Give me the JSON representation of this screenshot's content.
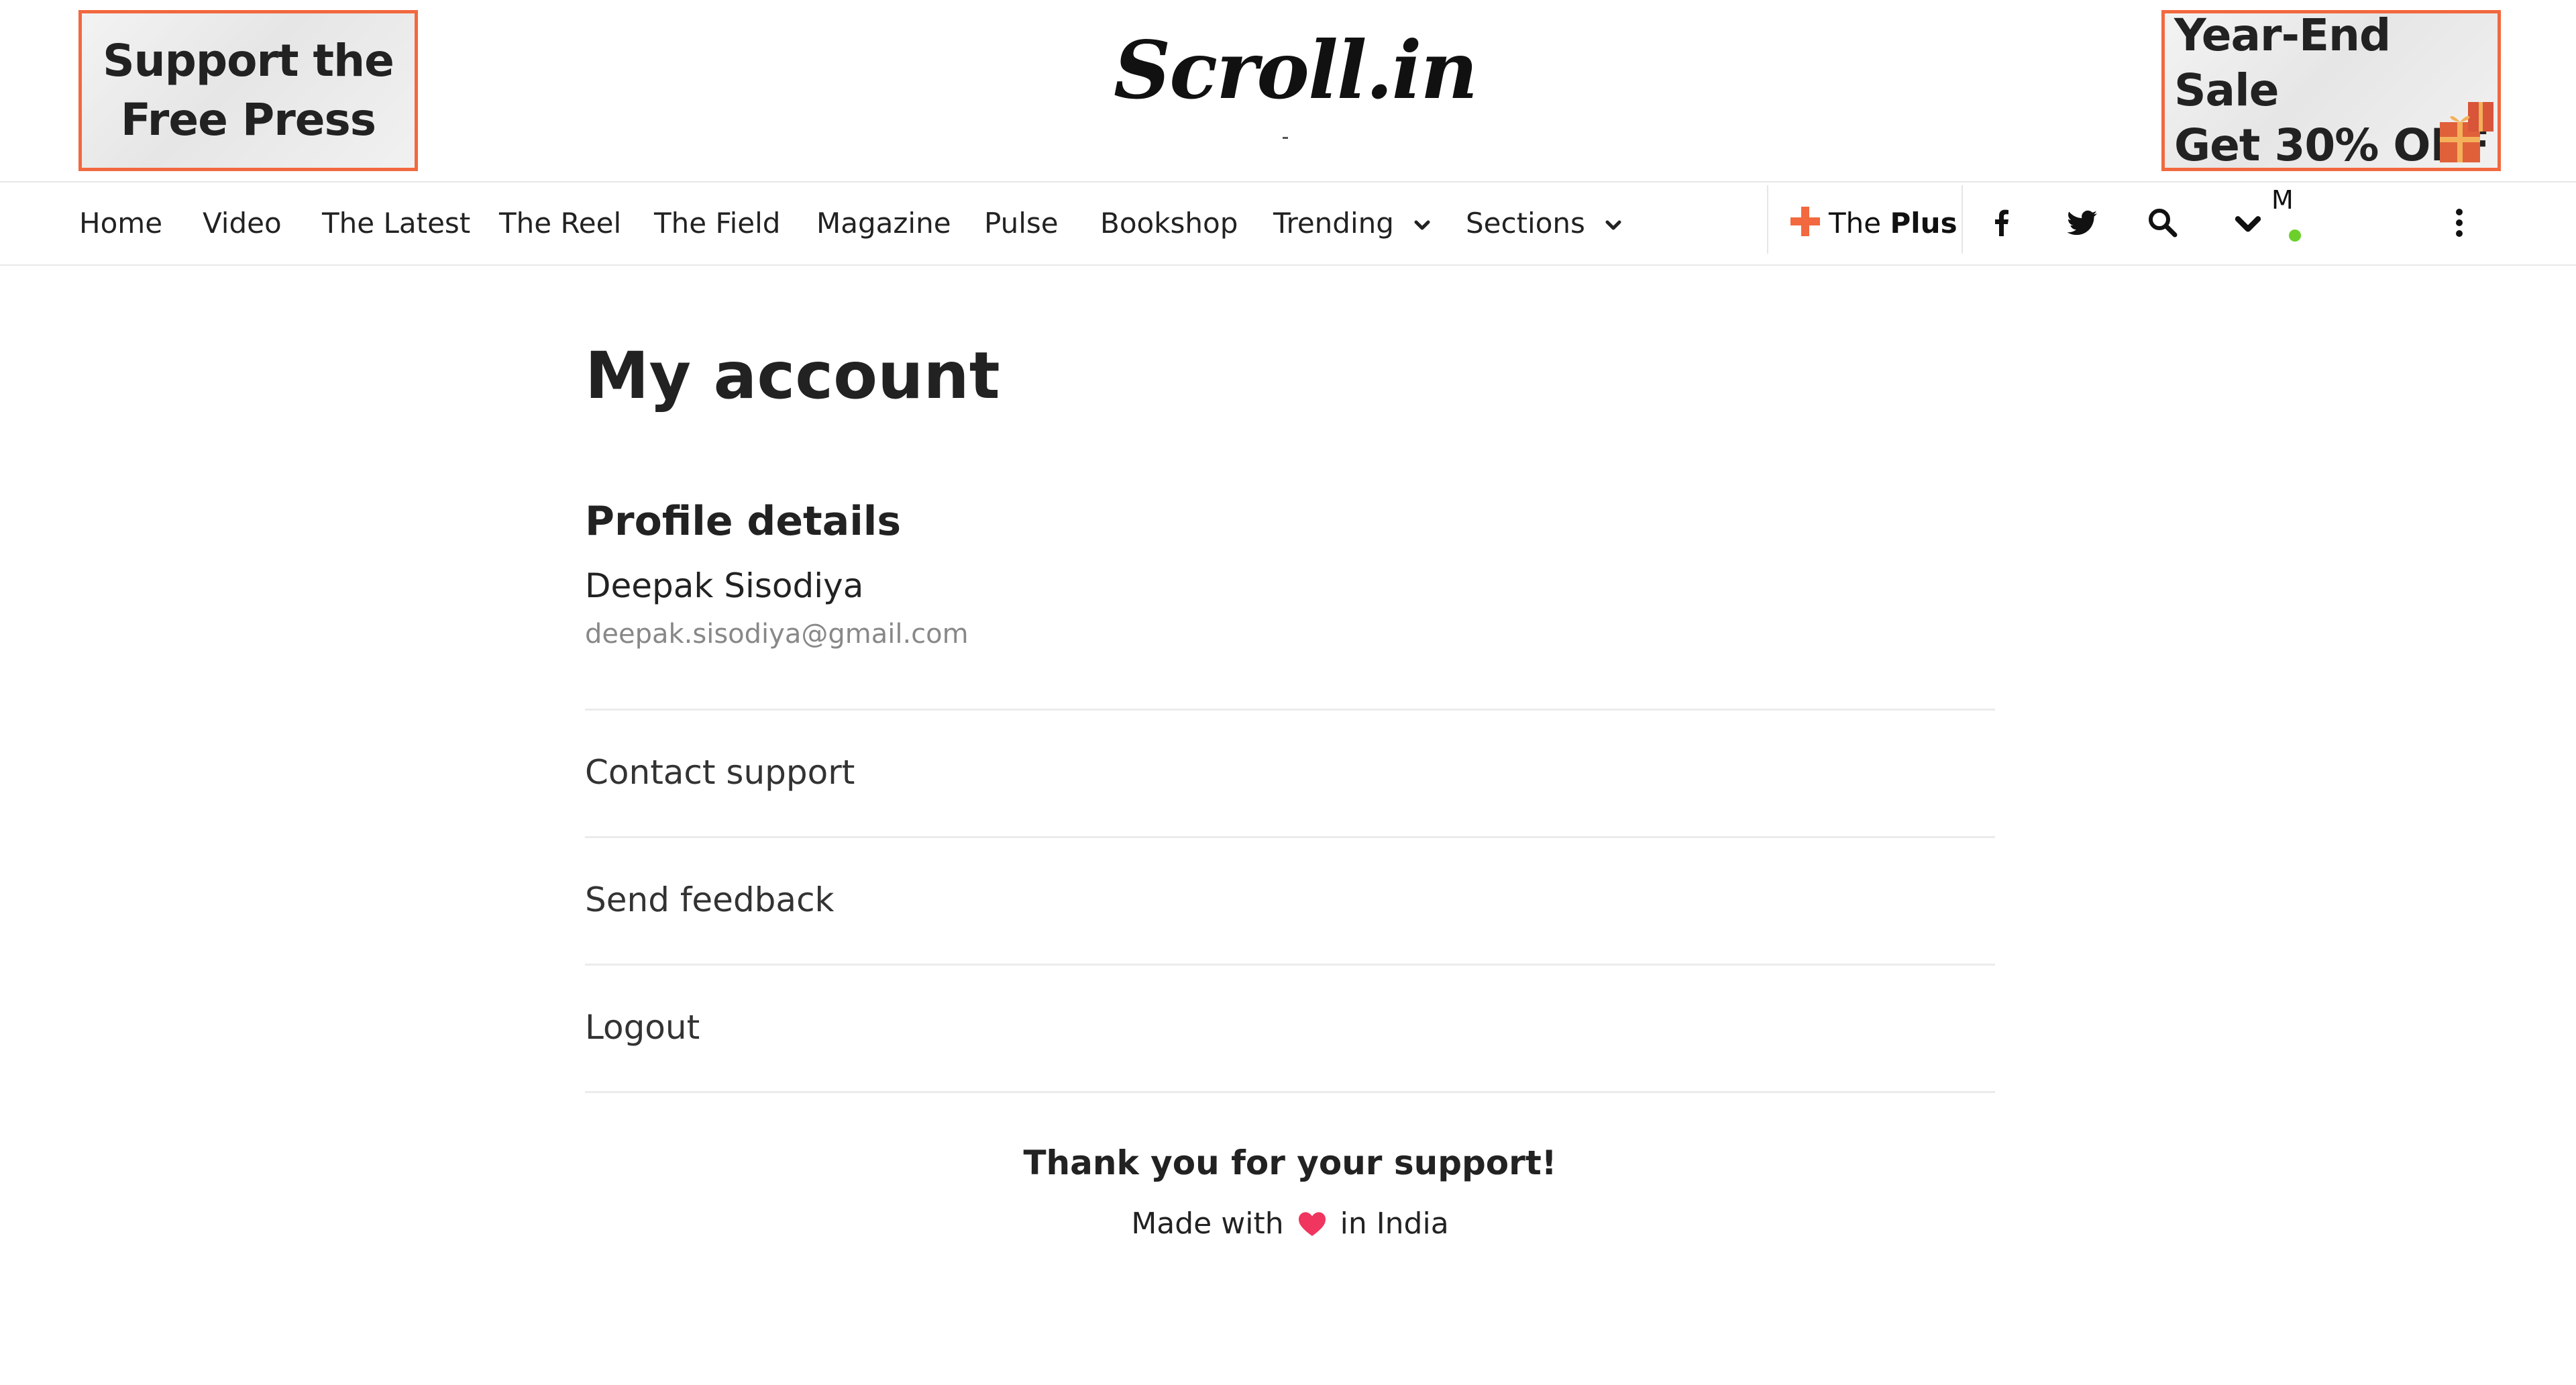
{
  "header": {
    "promo_left": {
      "line1": "Support the",
      "line2": "Free Press"
    },
    "logo": "Scroll.in",
    "promo_right": {
      "line1": "Year-End Sale",
      "line2": "Get 30% OFF"
    }
  },
  "nav": {
    "items": [
      "Home",
      "Video",
      "The Latest",
      "The Reel",
      "The Field",
      "Magazine",
      "Pulse",
      "Bookshop",
      "Trending",
      "Sections"
    ],
    "plus": {
      "prefix": "The",
      "bold": "Plus"
    },
    "avatar_initial": "M",
    "icons": [
      "facebook-icon",
      "twitter-icon",
      "search-icon",
      "chevron-down-icon",
      "more-vertical-icon"
    ]
  },
  "account": {
    "title": "My account",
    "profile_heading": "Profile details",
    "name": "Deepak Sisodiya",
    "email": "deepak.sisodiya@gmail.com",
    "menu": [
      "Contact support",
      "Send feedback",
      "Logout"
    ]
  },
  "footer": {
    "thanks": "Thank you for your support!",
    "made_prefix": "Made with",
    "made_suffix": "in India"
  },
  "colors": {
    "accent": "#f2683f",
    "heart": "#f0355e",
    "online": "#6bd12a",
    "muted_text": "#888888"
  }
}
